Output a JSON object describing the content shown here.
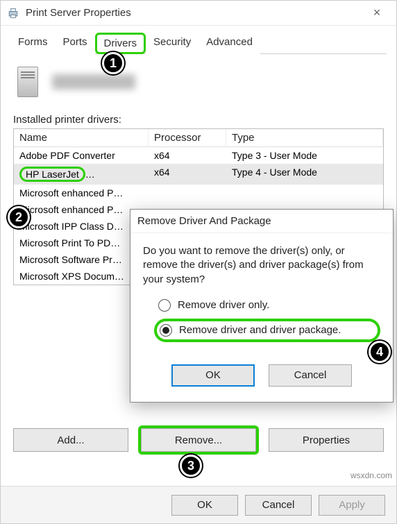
{
  "window": {
    "title": "Print Server Properties"
  },
  "tabs": {
    "items": [
      "Forms",
      "Ports",
      "Drivers",
      "Security",
      "Advanced"
    ],
    "active_index": 2
  },
  "section": {
    "label": "Installed printer drivers:"
  },
  "table": {
    "columns": [
      "Name",
      "Processor",
      "Type"
    ],
    "rows": [
      {
        "name": "Adobe PDF Converter",
        "processor": "x64",
        "type": "Type 3 - User Mode",
        "blurred": false
      },
      {
        "name": "HP LaserJet",
        "processor": "x64",
        "type": "Type 4 - User Mode",
        "blurred": true,
        "selected": true
      },
      {
        "name": "Microsoft enhanced P…",
        "processor": "",
        "type": "",
        "blurred": false
      },
      {
        "name": "Microsoft enhanced P…",
        "processor": "",
        "type": "",
        "blurred": false
      },
      {
        "name": "Microsoft IPP Class D…",
        "processor": "",
        "type": "",
        "blurred": false
      },
      {
        "name": "Microsoft Print To PD…",
        "processor": "",
        "type": "",
        "blurred": false
      },
      {
        "name": "Microsoft Software Pr…",
        "processor": "",
        "type": "",
        "blurred": false
      },
      {
        "name": "Microsoft XPS Docum…",
        "processor": "",
        "type": "",
        "blurred": false
      }
    ]
  },
  "buttons": {
    "add": "Add...",
    "remove": "Remove...",
    "properties": "Properties"
  },
  "bottom": {
    "ok": "OK",
    "cancel": "Cancel",
    "apply": "Apply"
  },
  "dialog": {
    "title": "Remove Driver And Package",
    "message": "Do you want to remove the driver(s) only, or remove the driver(s) and driver package(s) from your system?",
    "option1": "Remove driver only.",
    "option2": "Remove driver and driver package.",
    "ok": "OK",
    "cancel": "Cancel",
    "selected_index": 1
  },
  "callouts": {
    "n1": "1",
    "n2": "2",
    "n3": "3",
    "n4": "4"
  },
  "watermark": "wsxdn.com"
}
